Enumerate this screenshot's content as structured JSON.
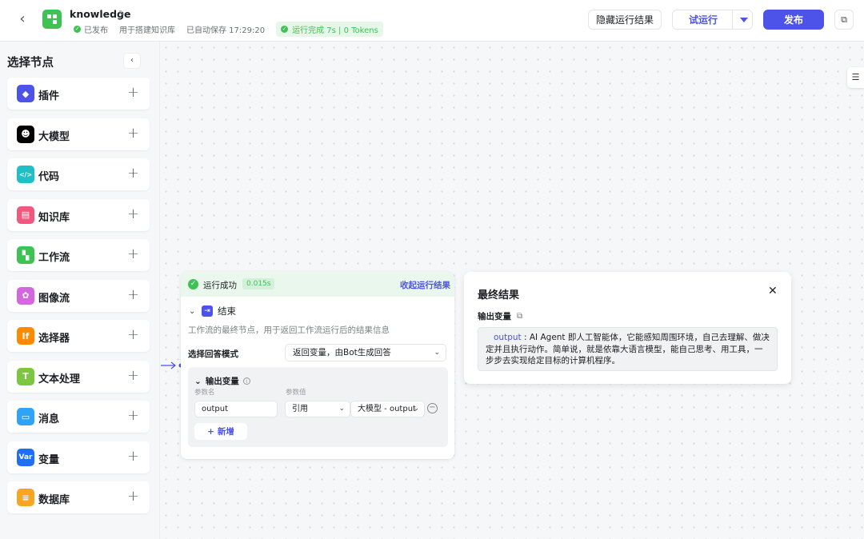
{
  "header": {
    "back_icon": "arrow-left-icon",
    "app_name": "knowledge",
    "status": "已发布",
    "purpose": "用于搭建知识库",
    "autosave": "已自动保存 17:29:20",
    "run_badge": "运行完成 7s | 0 Tokens",
    "hide_result": "隐藏运行结果",
    "test_run": "试运行",
    "publish": "发布",
    "colors": {
      "accent": "#4d53e8",
      "success": "#3ec254"
    }
  },
  "sidebar": {
    "title": "选择节点",
    "items": [
      {
        "label": "插件",
        "icon": "cube-icon",
        "color": "#4d53e8"
      },
      {
        "label": "大模型",
        "icon": "llm-face-icon",
        "color": "#000000"
      },
      {
        "label": "代码",
        "icon": "code-icon",
        "color": "#1fbfc6"
      },
      {
        "label": "知识库",
        "icon": "book-icon",
        "color": "#f0597d"
      },
      {
        "label": "工作流",
        "icon": "workflow-icon",
        "color": "#3ec254"
      },
      {
        "label": "图像流",
        "icon": "image-flow-icon",
        "color": "#d467e0"
      },
      {
        "label": "选择器",
        "icon": "if-icon",
        "color": "#ff8a00"
      },
      {
        "label": "文本处理",
        "icon": "text-process-icon",
        "color": "#7cc642"
      },
      {
        "label": "消息",
        "icon": "message-icon",
        "color": "#2fa3f5"
      },
      {
        "label": "变量",
        "icon": "var-icon",
        "color": "#1f6ef5",
        "icon_text": "Var"
      },
      {
        "label": "数据库",
        "icon": "database-icon",
        "color": "#f5a623"
      }
    ]
  },
  "node": {
    "status": "运行成功",
    "time": "0.015s",
    "fold": "收起运行结果",
    "title": "结束",
    "desc": "工作流的最终节点，用于返回工作流运行后的结果信息",
    "mode_label": "选择回答模式",
    "mode_value": "返回变量，由Bot生成回答",
    "output_title": "输出变量",
    "col_name": "参数名",
    "col_value": "参数值",
    "param_name": "output",
    "param_type": "引用",
    "param_ref": "大模型 - output",
    "add": "新增"
  },
  "result": {
    "title": "最终结果",
    "sub": "输出变量",
    "key": "output",
    "value": " : AI Agent 即人工智能体，它能感知周围环境，自己去理解、做决定并且执行动作。简单说，就是依靠大语言模型，能自己思考、用工具，一步步去实现给定目标的计算机程序。"
  }
}
